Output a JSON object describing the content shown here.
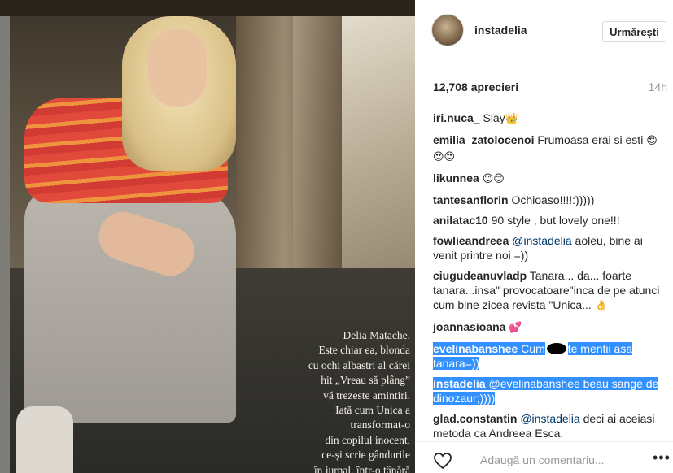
{
  "photo": {
    "caption": "Delia Matache.\nEste chiar ea, blonda\ncu ochi albastri al cărei\nhit „Vreau să plâng”\nvă trezeste amintiri.\nIată cum Unica a\ntransformat-o\ndin copilul inocent,\nce-și scrie gândurile\nîn jurnal, într-o tânără"
  },
  "header": {
    "username": "instadelia",
    "follow_label": "Urmărești"
  },
  "post": {
    "likes": "12,708 aprecieri",
    "time": "14h"
  },
  "comments": [
    {
      "user": "iri.nuca_",
      "text": " Slay",
      "emoji": "👑"
    },
    {
      "user": "emilia_zatolocenoi",
      "text": " Frumoasa erai si esti ",
      "emoji": "😍😍😍"
    },
    {
      "user": "likunnea",
      "text": " ",
      "emoji": "😊😊"
    },
    {
      "user": "tantesanflorin",
      "text": " Ochioaso!!!!:)))))"
    },
    {
      "user": "anilatac10",
      "text": " 90 style , but lovely one!!!"
    },
    {
      "user": "fowlieandreea",
      "mention": "@instadelia",
      "text": " aoleu, bine ai venit printre noi =))"
    },
    {
      "user": "ciugudeanuvladp",
      "text": " Tanara... da... foarte tanara...insa\" provocatoare\"inca de pe atunci cum bine zicea revista \"Unica... ",
      "emoji": "👌"
    },
    {
      "user": "joannasioana",
      "text": " ",
      "emoji": "💕"
    },
    {
      "user": "evelinabanshee",
      "text_before": "Cum",
      "text_after": "te mentii asa tanara=))"
    },
    {
      "user": "instadelia",
      "mention": "@evelinabanshee",
      "text": " beau sange de dinozaur;))))"
    },
    {
      "user": "glad.constantin",
      "mention": "@instadelia",
      "text": " deci ai aceiasi metoda ca Andreea Esca."
    }
  ],
  "footer": {
    "placeholder": "Adaugă un comentariu...",
    "more_label": "•••",
    "heart_icon": "heart-outline-icon"
  }
}
